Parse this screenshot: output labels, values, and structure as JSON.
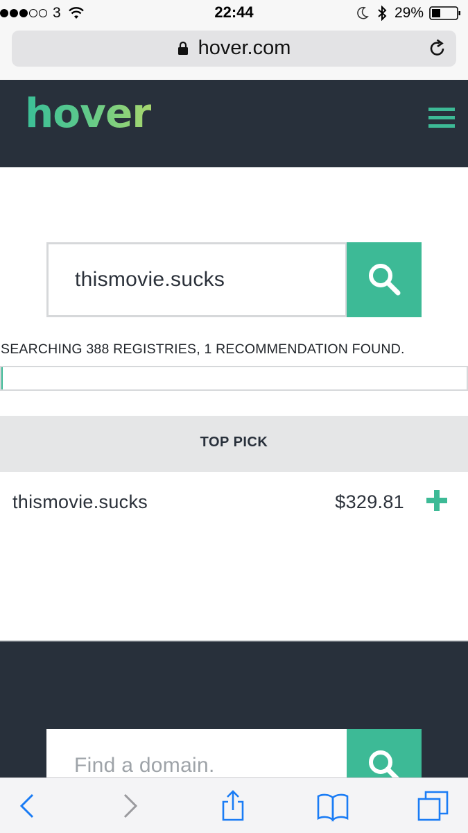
{
  "status_bar": {
    "carrier": "3",
    "time": "22:44",
    "battery_percent": "29%"
  },
  "browser": {
    "url": "hover.com"
  },
  "header": {
    "logo_text": "hover"
  },
  "search": {
    "query": "thismovie.sucks",
    "status_text": "SEARCHING 388 REGISTRIES, 1 RECOMMENDATION FOUND.",
    "progress": 0.003
  },
  "results": {
    "section_label": "TOP PICK",
    "items": [
      {
        "domain": "thismovie.sucks",
        "price": "$329.81"
      }
    ]
  },
  "footer": {
    "search_placeholder": "Find a domain."
  },
  "colors": {
    "accent": "#3dba96",
    "header_bg": "#28303b"
  }
}
